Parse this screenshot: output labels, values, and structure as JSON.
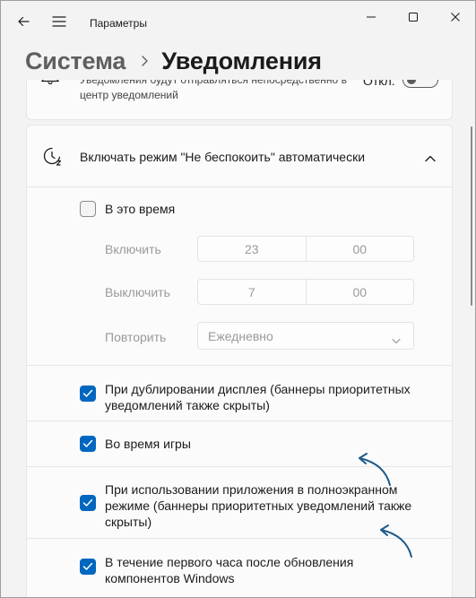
{
  "window": {
    "app_title": "Параметры",
    "controls": [
      "minimize-icon",
      "maximize-icon",
      "close-icon"
    ]
  },
  "breadcrumb": {
    "parent": "Система",
    "current": "Уведомления"
  },
  "top_setting": {
    "description": "Уведомления будут отправляться непосредственно в центр уведомлений",
    "toggle_label": "Откл.",
    "toggle_on": false
  },
  "dnd": {
    "title": "Включать режим \"Не беспокоить\" автоматически",
    "expanded": true,
    "time_rule": {
      "label": "В это время",
      "checked": false,
      "start_label": "Включить",
      "start_hour": "23",
      "start_minute": "00",
      "end_label": "Выключить",
      "end_hour": "7",
      "end_minute": "00",
      "repeat_label": "Повторить",
      "repeat_value": "Ежедневно"
    },
    "rules": [
      {
        "line1": "При дублировании дисплея (баннеры приоритетных",
        "line2": "уведомлений также скрыты)",
        "line3": "",
        "checked": true
      },
      {
        "line1": "Во время игры",
        "line2": "",
        "line3": "",
        "checked": true
      },
      {
        "line1": "При использовании приложения в полноэкранном",
        "line2": "режиме (баннеры приоритетных уведомлений также",
        "line3": "скрыты)",
        "checked": true
      },
      {
        "line1": "В течение первого часа после обновления",
        "line2": "компонентов Windows",
        "line3": "",
        "checked": true
      }
    ]
  },
  "colors": {
    "accent": "#0067c0",
    "annotation_arrow": "#1f5a8a",
    "background": "#f3f3f3",
    "card": "#fbfbfb"
  }
}
